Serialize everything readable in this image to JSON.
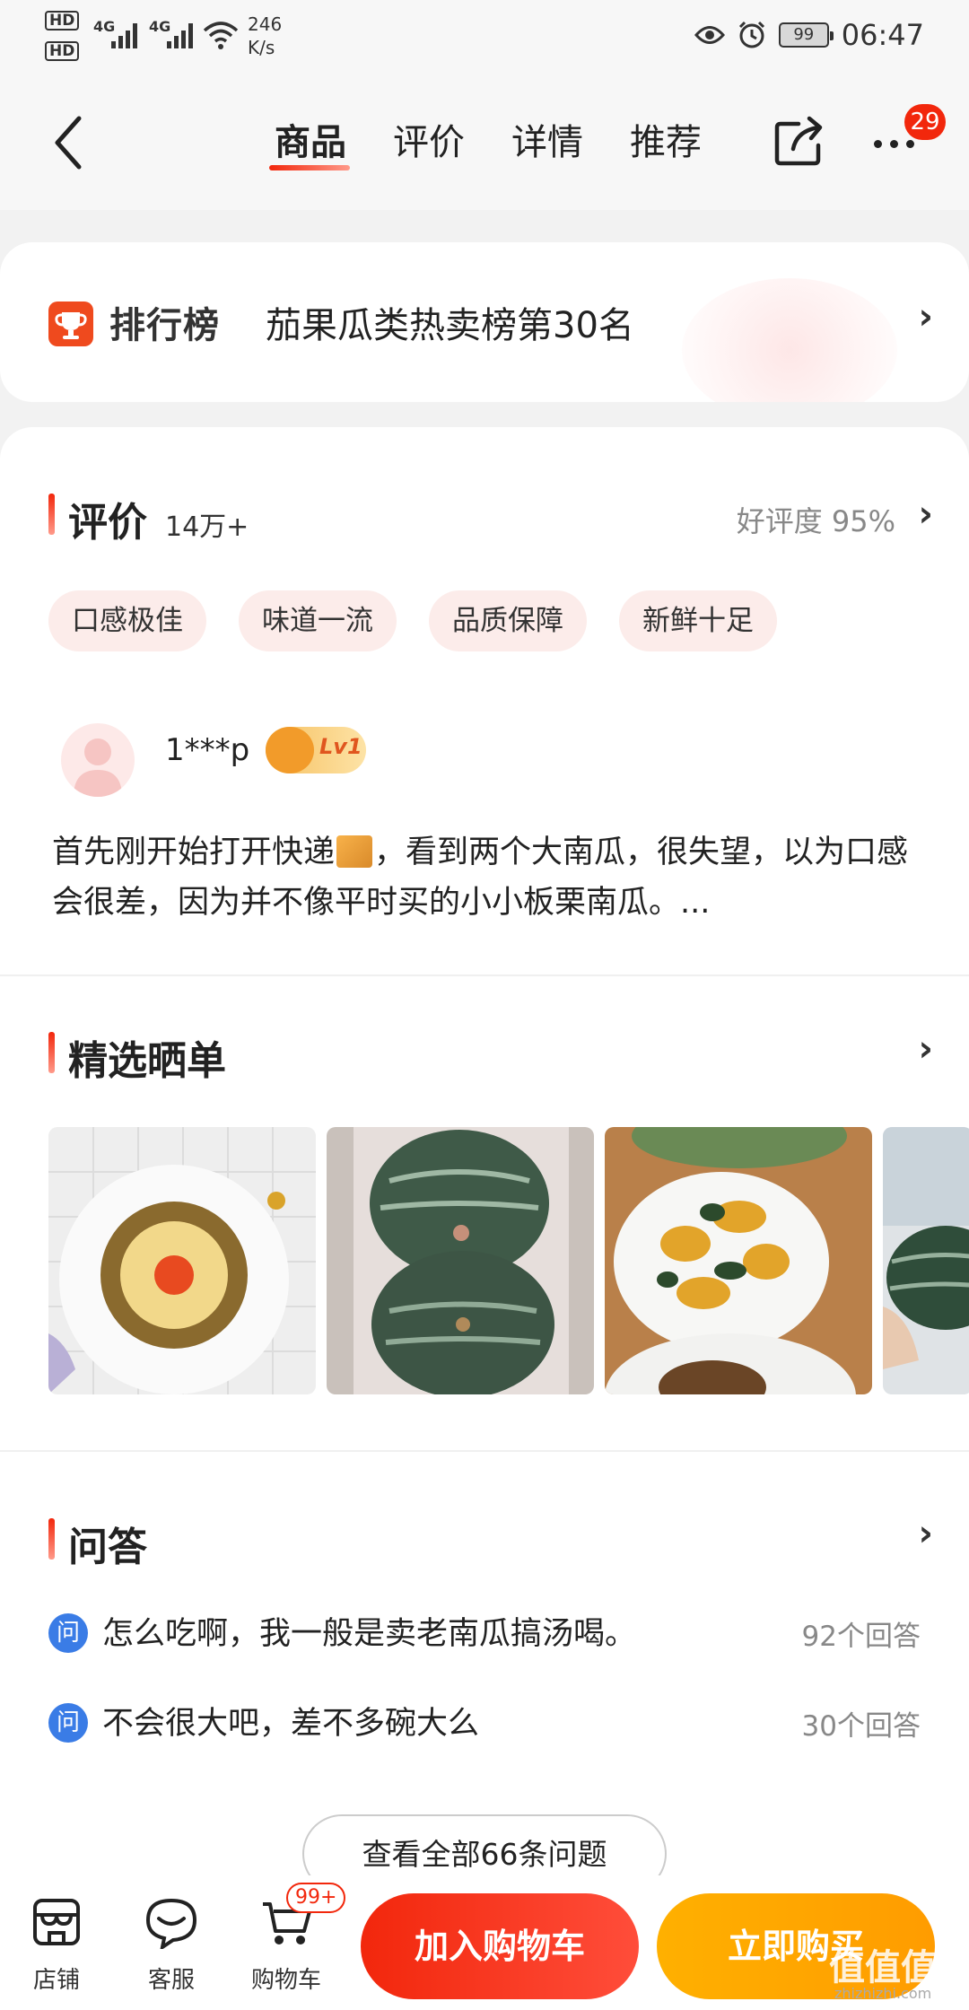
{
  "status_bar": {
    "hd1": "HD",
    "hd2": "HD",
    "net1": "4G",
    "net2": "4G",
    "speed_value": "246",
    "speed_unit": "K/s",
    "battery": "99",
    "time": "06:47"
  },
  "header": {
    "tabs": [
      {
        "label": "商品"
      },
      {
        "label": "评价"
      },
      {
        "label": "详情"
      },
      {
        "label": "推荐"
      }
    ],
    "more_badge": "29"
  },
  "rank": {
    "brand": "排行榜",
    "text": "茄果瓜类热卖榜第30名"
  },
  "reviews": {
    "title": "评价",
    "count": "14万+",
    "good_rate": "好评度 95%",
    "tags": [
      "口感极佳",
      "味道一流",
      "品质保障",
      "新鲜十足"
    ],
    "user": "1***p",
    "level": "Lv1",
    "text_part1": "首先刚开始打开快递",
    "text_part2": "，看到两个大南瓜，很失望，以为口感会很差，因为并不像平时买的小小板栗南瓜。..."
  },
  "showcase": {
    "title": "精选晒单"
  },
  "qa": {
    "title": "问答",
    "icon_text": "问",
    "items": [
      {
        "question": "怎么吃啊，我一般是卖老南瓜搞汤喝。",
        "answers": "92个回答"
      },
      {
        "question": "不会很大吧，差不多碗大么",
        "answers": "30个回答"
      }
    ],
    "view_all": "查看全部66条问题"
  },
  "bottom_bar": {
    "store": "店铺",
    "service": "客服",
    "cart": "购物车",
    "cart_badge": "99+",
    "add_to_cart": "加入购物车",
    "buy_now": "立即购买"
  },
  "watermark": {
    "text": "值值值",
    "sub": "zhizhizhi.com"
  },
  "colors": {
    "accent_red": "#f2270c",
    "accent_orange": "#ff9c00",
    "qa_blue": "#3a7ce6"
  }
}
